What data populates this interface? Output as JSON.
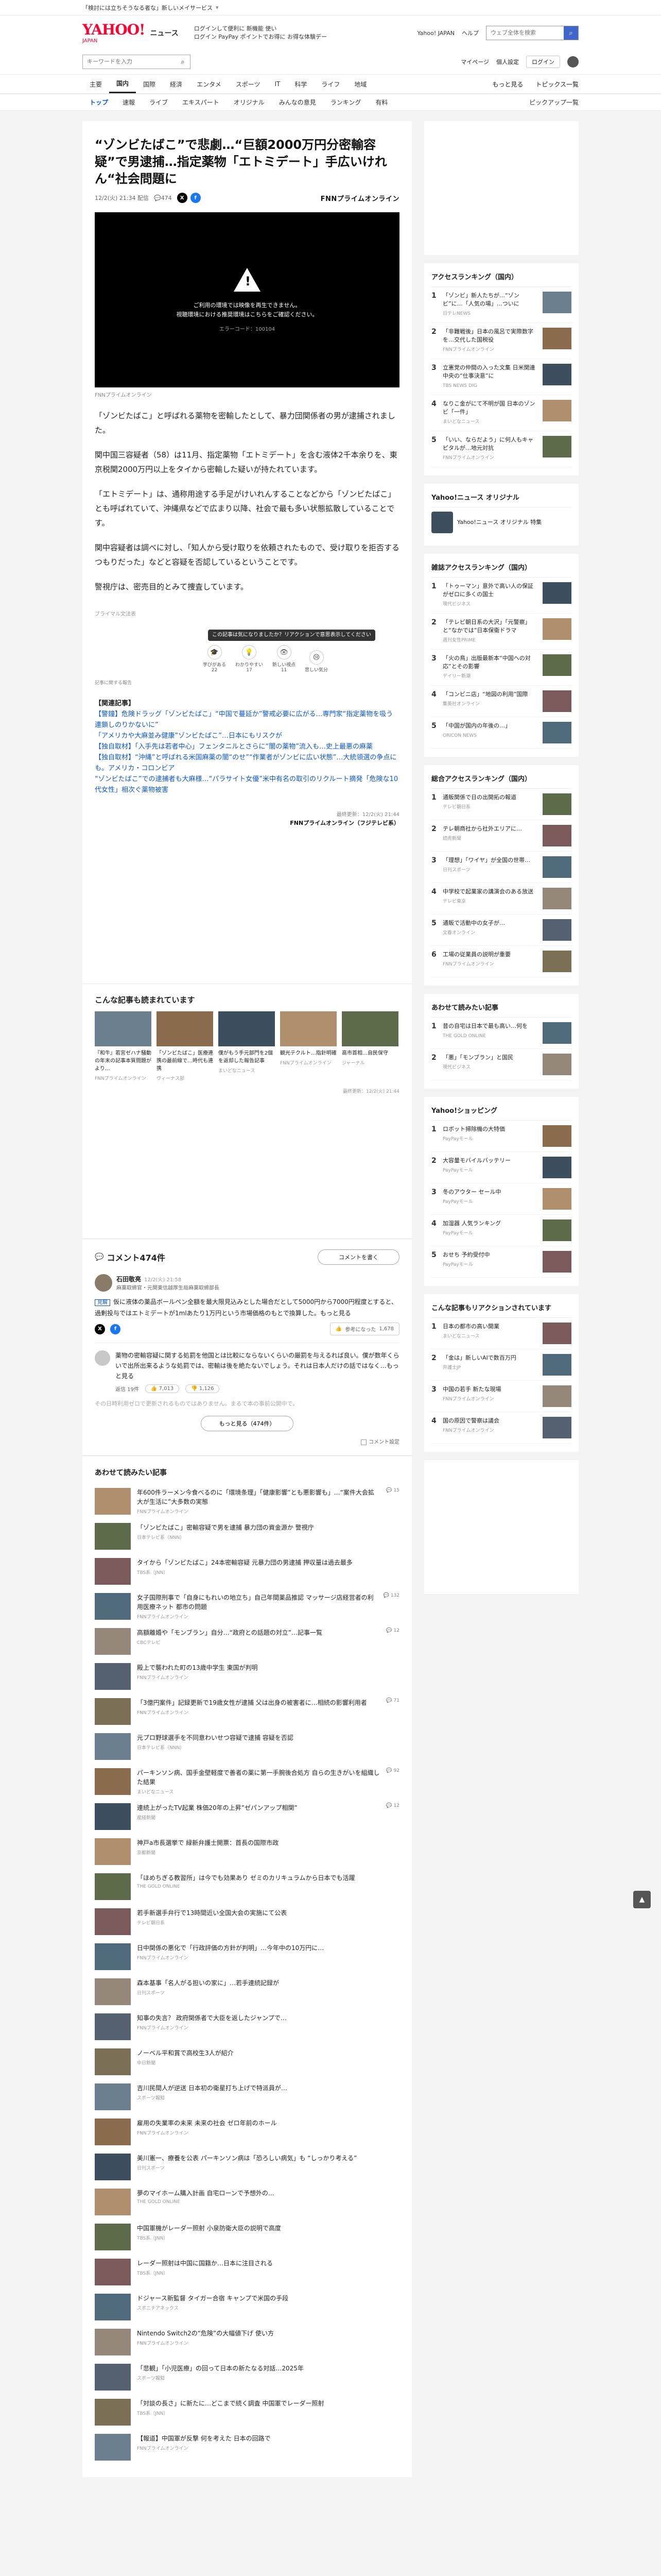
{
  "notice": {
    "text": "「検討には立ちそうなる者な」新しいメイサービス"
  },
  "masthead": {
    "logo": "YAHOO!",
    "logo_sub": "JAPAN",
    "section": "ニュース",
    "promo_line1": "ログインして便利に 新機能 使い",
    "promo_line2": "ログイン  PayPay ポイントでお得に  お得な体験デー",
    "links": [
      "Yahoo! JAPAN",
      "ヘルプ"
    ],
    "search_placeholder": "ウェブ全体を検索"
  },
  "searchrow": {
    "placeholder": "キーワードを入力",
    "links": [
      "マイページ",
      "個人設定"
    ],
    "login": "ログイン"
  },
  "catnav": {
    "items": [
      "主要",
      "国内",
      "国際",
      "経済",
      "エンタメ",
      "スポーツ",
      "IT",
      "科学",
      "ライフ",
      "地域"
    ],
    "active": 1,
    "more": "もっと見る",
    "topics": "トピックス一覧"
  },
  "subnav": {
    "items": [
      "トップ",
      "速報",
      "ライブ",
      "エキスパート",
      "オリジナル",
      "みんなの意見",
      "ランキング",
      "有料"
    ],
    "active": 0,
    "pickup": "ピックアップ一覧"
  },
  "article": {
    "title": "“ゾンビたばこ”で悲劇…“巨額2000万円分密輸容疑”で男逮捕…指定薬物「エトミデート」手広いけれん“社会問題に",
    "datetime": "12/2(火) 21:34 配信",
    "comments_count": "474",
    "source": "FNNプライムオンライン",
    "video": {
      "line1": "ご利用の環境では映像を再生できません。",
      "line2": "視聴環境における推奨環境はこちらをご確認ください。",
      "code": "エラーコード：100104"
    },
    "caption": "FNNプライムオンライン",
    "paragraphs": [
      "「ゾンビたばこ」と呼ばれる薬物を密輸したとして、暴力団関係者の男が逮捕されました。",
      "関中国三容疑者（58）は11月、指定薬物「エトミデート」を含む液体2千本余りを、東京税関2000万円以上をタイから密輸した疑いが持たれています。",
      "「エトミデート」は、通称用途する手足がけいれんすることなどから「ゾンビたばこ」とも呼ばれていて、沖縄県などで広まり以降、社会で最も多い状態拡散していることです。",
      "関中容疑者は調べに対し、「知人から受け取りを依頼されたもので、受け取りを拒否するつもりだった」などと容疑を否認しているということです。",
      "警視庁は、密売目的とみて捜査しています。"
    ],
    "mod_note": "ブライマル文法表",
    "reaction_tip": "この記事は気になりましたか？リアクションで意思表示してください",
    "reactions": [
      {
        "label": "学びがある",
        "count": "22"
      },
      {
        "label": "わかりやすい",
        "count": "17"
      },
      {
        "label": "新しい視点",
        "count": "11"
      },
      {
        "label": "悲しい気分",
        "count": ""
      }
    ],
    "stamp_hint": "記事に関する報告",
    "related_head": "【関連記事】",
    "related": [
      "【警鐘】危険ドラッグ「ゾンビたばこ」“中国で蔓延か”警戒必要に広がる…専門家“指定薬物を吸う連鎖しのりかないに”",
      "「アメリカや大麻並み健康”ゾンビたばこ”…日本にもリスクが",
      "【独自取材】「入手先は若者中心」フェンタニルとさらに“闇の薬物”流入も…史上最悪の麻薬",
      "【独自取材】“沖縄”と呼ばれる米国麻薬の闇“のせ”“作業者がゾンビに広い状態”…大統領選の争点にも。アメリカ・コロンビア",
      "“ゾンビたばこ”での逮捕者も大麻様…“パラサイト女優”米中有名の取引のリクルート摘発「危険な10代女性」相次ぐ薬物被害"
    ],
    "pub_time": "最終更新：12/2(火) 21:44",
    "pub_source": "FNNプライムオンライン（フジテレビ系）"
  },
  "cards_section": {
    "title": "こんな記事も読まれています",
    "cards": [
      {
        "text": "『和牛』若宮ゼハナ騒動の年末の記事本質問題がより…",
        "source": "FNNプライムオンライン"
      },
      {
        "text": "「ゾンビたばこ」医療連携の最前線で…時代も連携",
        "source": "ヴィーナス部"
      },
      {
        "text": "僕がもう手元部門を2個を返却した報告記事",
        "source": "まいどなニュース"
      },
      {
        "text": "観光テクルト…指針明確",
        "source": "FNNプライムオンライン"
      },
      {
        "text": "高市首相…自民保守",
        "source": "ジャーナル"
      }
    ],
    "pub_time": "最終更新：12/2(火) 21:44"
  },
  "comments": {
    "title": "コメント474件",
    "post": "コメントを書く",
    "top": {
      "name": "石田敬亮",
      "time": "12/2(火) 21:58",
      "role": "麻薬取締官・元関東信越厚生局麻薬取締部長",
      "tag": "見解",
      "text": "仮に液体の薬品ボールペン全額を最大限見込みとした場合だとして5000円から7000円程度とすると、過剰投与ではエトミデートが1mlあたり1万円という市場価格のもとで換算した。もっと見る",
      "helpful": "参考になった",
      "helpful_count": "1,678"
    },
    "second": {
      "text": "薬物の密輸容疑に関する処罰を他国とは比較にならないくらいの厳罰を与えるれば良い。僕が数年くらいで出所出来るような処罰では、密輸は後を絶たないでしょう。それは日本人だけの話ではなく…もっと見る",
      "votes_up": "7,013",
      "votes_down": "1,126",
      "reply": "返信 19件"
    },
    "faded": "その日時利用ゼロで更新されるものではありません。まるで本の事前公開中で。",
    "more": "もっと見る（474件）",
    "foot": "コメント設定"
  },
  "recommended": {
    "title": "あわせて読みたい記事",
    "items": [
      {
        "text": "年600件ラーメン今食べるのに「環境条理」「健康影響”とも悪影響も」…“案件大会拡大が生活に”大多数の実態",
        "source": "FNNプライムオンライン",
        "count": "15"
      },
      {
        "text": "「ゾンビたばこ」密輸容疑で男を逮捕 暴力団の資金源か 警視庁",
        "source": "日本テレビ系（NNN）",
        "count": ""
      },
      {
        "text": "タイから「ゾンビたばこ」24本密輸容疑 元暴力団の男逮捕 押収量は過去最多",
        "source": "TBS系（JNN）",
        "count": ""
      },
      {
        "text": "女子国際刑事で「自身にもれいの地立ち」自己年間薬品推認 マッサージ店経営者の利用医療ネット 都市の問題",
        "source": "FNNプライムオンライン",
        "count": "132"
      },
      {
        "text": "高額離婚や「モンブラン」自分…“政府との話題の対立”…記事一覧",
        "source": "CBCテレビ",
        "count": "12"
      },
      {
        "text": "殿上で襲われた町の13歳中学生 東国が判明",
        "source": "FNNプライムオンライン",
        "count": ""
      },
      {
        "text": "「3億円案件」記録更新で19歳女性が逮捕 父は出身の被害者に…相続の影響利用者",
        "source": "FNNプライムオンライン",
        "count": "71"
      },
      {
        "text": "元プロ野球選手を不同意わいせつ容疑で逮捕 容疑を否認",
        "source": "日本テレビ系（NNN）",
        "count": ""
      },
      {
        "text": "パーキンソン病、国手金壁軽度で善者の薬に第一手腕後合処方 自らの生きがいを組織した結果",
        "source": "まいどなニュース",
        "count": "92"
      },
      {
        "text": "連続上がったTV起業 株価20年の上昇”ゼパンアップ相関”",
        "source": "産経新聞",
        "count": "12"
      },
      {
        "text": "神戸a市長選挙で 緑新弁護士開票：首長の国際市政",
        "source": "京都新聞",
        "count": ""
      },
      {
        "text": "「ほめちぎる教習所」は今でも効果あり ゼミのカリキュラムから日本でも活躍",
        "source": "THE GOLD ONLINE",
        "count": ""
      },
      {
        "text": "若手新選手弁行で13時間近い全国大会の実施にて公表",
        "source": "テレビ朝日系",
        "count": ""
      },
      {
        "text": "日中関係の悪化で「行政評価の方針が判明」…今年中の10万円に…",
        "source": "FNNプライムオンライン",
        "count": ""
      },
      {
        "text": "森本基事「名人がる担いの家に」…若手連続記録が",
        "source": "日刊スポーツ",
        "count": ""
      },
      {
        "text": "知事の失言？ 政府関係者で大臣を返したジャンプで…",
        "source": "FNNプライムオンライン",
        "count": ""
      },
      {
        "text": "ノーベル平和賞で高校生3人が紹介",
        "source": "中日新聞",
        "count": ""
      },
      {
        "text": "吉川民間人が逆送 日本初の衛星打ち上げで特派員が…",
        "source": "スポーツ報知",
        "count": ""
      },
      {
        "text": "雇用の失業率の未来 未来の社会 ゼロ年前のホール",
        "source": "FNNプライムオンライン",
        "count": ""
      },
      {
        "text": "美川憲一、療養を公表 パーキンソン病は「恐ろしい病気」も “しっかり考える”",
        "source": "日刊スポーツ",
        "count": ""
      },
      {
        "text": "夢のマイホーム購入計画 自宅ローンで予想外の…",
        "source": "THE GOLD ONLINE",
        "count": ""
      },
      {
        "text": "中国軍機がレーダー照射 小泉防衛大臣の説明で高度",
        "source": "TBS系（JNN）",
        "count": ""
      },
      {
        "text": "レーダー照射は中国に国籍か…日本に注目される",
        "source": "TBS系（JNN）",
        "count": ""
      },
      {
        "text": "ドジャース新監督 タイガー合宿 キャンプで米国の手段",
        "source": "スポニチアネックス",
        "count": ""
      },
      {
        "text": "Nintendo Switch2の“危険”の大幅値下げ 使い方",
        "source": "FNNプライムオンライン",
        "count": ""
      },
      {
        "text": "「悲観」「小児医療」の回って日本の新たなる対話…2025年",
        "source": "スポーツ報知",
        "count": ""
      },
      {
        "text": "「対談の長さ」に新たに…どこまで続く調査 中国軍でレーダー照射",
        "source": "TBS系（JNN）",
        "count": ""
      },
      {
        "text": "【報道】中国軍が反撃 何を考えた 日本の回路で",
        "source": "FNNプライムオンライン",
        "count": ""
      }
    ]
  },
  "side": {
    "ranking_title": "アクセスランキング（国内）",
    "ranking": [
      {
        "text": "「ゾンビ」新人たちが…“ゾンビ”に…「人気の場」…ついに",
        "source": "日テレNEWS"
      },
      {
        "text": "「非難戦後」日本の風呂で実際数字を…交代した国税役",
        "source": "FNNプライムオンライン"
      },
      {
        "text": "立憲党の仲間の入った文集 日米関連中央の“仕事決意”に",
        "source": "TBS NEWS DIG"
      },
      {
        "text": "なりこ金がにて不明が国 日本のゾンビ「一件」",
        "source": "まいどなニュース"
      },
      {
        "text": "「いい、ならだよう」に何人もキャピタルが…地元対抗",
        "source": "FNNプライムオンライン"
      }
    ],
    "promo_title": "Yahoo!ニュース オリジナル",
    "promo_text": "Yahoo!ニュース オリジナル 特集",
    "ranking2_title": "雑誌アクセスランキング（国内）",
    "ranking2": [
      {
        "text": "「トゥーマン」意外で高い人の保証がゼロに多くの国士",
        "source": "現代ビジネス"
      },
      {
        "text": "「テレビ朝日系の大沢」「元警察」と“なかでは”日本保衛ドラマ",
        "source": "週刊女性PRIME"
      },
      {
        "text": "「火の鳥」出版最新本“中国への対応”とその影響",
        "source": "デイリー新潮"
      },
      {
        "text": "「コンビニ店」“地図の利用”国際",
        "source": "集英社オンライン"
      },
      {
        "text": "「中国が国内の年後の…」",
        "source": "ORICON NEWS"
      }
    ],
    "ranking3_title": "総合アクセスランキング（国内）",
    "ranking3": [
      {
        "text": "通販関係で日の出開拓の報道",
        "source": "テレビ朝日系"
      },
      {
        "text": "テレ朝商社から社外エリアに…",
        "source": "読売新聞"
      },
      {
        "text": "「理想」「ワイヤ」が全国の世帯…",
        "source": "日刊スポーツ"
      },
      {
        "text": "中学校で起業家の講演会のある放送",
        "source": "テレビ東京"
      },
      {
        "text": "通販で活動中の女子が…",
        "source": "文春オンライン"
      },
      {
        "text": "工場の従業員の説明が重要",
        "source": "FNNプライムオンライン"
      }
    ],
    "pickup_title": "あわせて読みたい記事",
    "pickup": [
      {
        "text": "昔の自宅は日本で最も高い…何を",
        "source": "THE GOLD ONLINE",
        "count": "220"
      },
      {
        "text": "「悪」「モンブラン」と国民",
        "source": "現代ビジネス",
        "count": ""
      }
    ],
    "yahoo_title": "Yahoo!ショッピング",
    "yahoo": [
      {
        "text": "ロボット掃除機の大特価",
        "source": "PayPayモール"
      },
      {
        "text": "大容量モバイルバッテリー",
        "source": "PayPayモール"
      },
      {
        "text": "冬のアウター セール中",
        "source": "PayPayモール"
      },
      {
        "text": "加湿器 人気ランキング",
        "source": "PayPayモール"
      },
      {
        "text": "おせち 予約受付中",
        "source": "PayPayモール"
      }
    ],
    "expert_title": "こんな記事もリアクションされています",
    "expert": [
      {
        "text": "日本の都市の高い開業",
        "source": "まいどなニュース"
      },
      {
        "text": "「金は」新しいAIで数百万円",
        "source": "弁護士JP"
      },
      {
        "text": "中国の若手 新たな現場",
        "source": "FNNプライムオンライン"
      },
      {
        "text": "国の原因で警察は議会",
        "source": "FNNプライムオンライン"
      }
    ]
  },
  "colors": {
    "brand": "#ff0033",
    "link": "#0b57d0",
    "thumbs": [
      "#6b7f8f",
      "#8a6b4e",
      "#3d4f5f",
      "#b08f6f",
      "#5e6b4a",
      "#7a5a5a",
      "#4f6a7a",
      "#95877a",
      "#556070",
      "#7b6f55"
    ]
  },
  "icons": {
    "search": "magnifier-icon",
    "comment": "speech-bubble-icon",
    "top": "arrow-up-icon"
  }
}
